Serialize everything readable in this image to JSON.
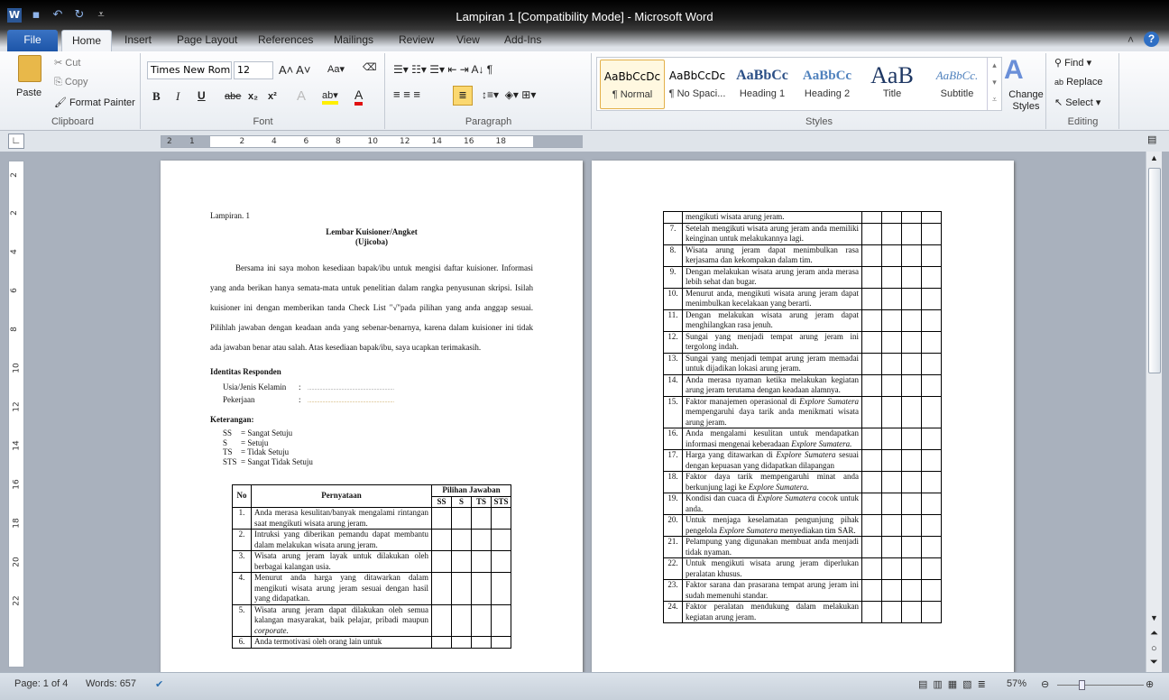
{
  "window": {
    "title": "Lampiran 1 [Compatibility Mode]  -  Microsoft Word"
  },
  "ribbon_tabs": [
    "File",
    "Home",
    "Insert",
    "Page Layout",
    "References",
    "Mailings",
    "Review",
    "View",
    "Add-Ins"
  ],
  "clipboard": {
    "paste": "Paste",
    "cut": "Cut",
    "copy": "Copy",
    "format_painter": "Format Painter",
    "label": "Clipboard"
  },
  "font": {
    "name": "Times New Rom",
    "size": "12",
    "label": "Font",
    "bold": "B",
    "italic": "I",
    "underline": "U",
    "strike": "abe"
  },
  "paragraph": {
    "label": "Paragraph"
  },
  "styles": {
    "label": "Styles",
    "items": [
      {
        "preview": "AaBbCcDc",
        "name": "¶ Normal",
        "selected": true
      },
      {
        "preview": "AaBbCcDc",
        "name": "¶ No Spaci..."
      },
      {
        "preview": "AaBbCc",
        "name": "Heading 1"
      },
      {
        "preview": "AaBbCc",
        "name": "Heading 2"
      },
      {
        "preview": "AaB",
        "name": "Title"
      },
      {
        "preview": "AaBbCc.",
        "name": "Subtitle"
      }
    ],
    "change_styles": "Change Styles"
  },
  "editing": {
    "label": "Editing",
    "find": "Find",
    "replace": "Replace",
    "select": "Select"
  },
  "ruler": {
    "h_numbers": [
      "2",
      "1",
      "2",
      "4",
      "6",
      "8",
      "10",
      "12",
      "14",
      "16",
      "18"
    ],
    "v_numbers": [
      "2",
      "2",
      "4",
      "6",
      "8",
      "10",
      "12",
      "14",
      "16",
      "18",
      "20",
      "22"
    ]
  },
  "doc": {
    "lampiran": "Lampiran. 1",
    "title1": "Lembar Kuisioner/Angket",
    "title2": "(Ujicoba)",
    "intro": "Bersama ini saya mohon kesediaan bapak/ibu untuk mengisi daftar kuisioner. Informasi yang anda berikan hanya semata-mata untuk penelitian dalam rangka penyusunan skripsi. Isilah kuisioner ini dengan memberikan tanda Check List \"√\"pada pilihan yang anda anggap sesuai. Pilihlah jawaban dengan keadaan anda yang sebenar-benarnya, karena dalam kuisioner ini tidak ada jawaban benar atau salah. Atas kesediaan bapak/ibu, saya ucapkan terimakasih.",
    "identitas": "Identitas Responden",
    "fields": [
      {
        "label": "Usia/Jenis Kelamin",
        "sep": ":",
        "value": "................................................................"
      },
      {
        "label": "Pekerjaan",
        "sep": ":",
        "value": "................................................................"
      }
    ],
    "keterangan": "Keterangan:",
    "legend": [
      {
        "k": "SS",
        "v": "=  Sangat Setuju"
      },
      {
        "k": "S",
        "v": "=  Setuju"
      },
      {
        "k": "TS",
        "v": "=  Tidak Setuju"
      },
      {
        "k": "STS",
        "v": "=  Sangat Tidak Setuju"
      }
    ],
    "table_head": {
      "no": "No",
      "pernyataan": "Pernyataan",
      "pilihan": "Pilihan Jawaban",
      "options": [
        "SS",
        "S",
        "TS",
        "STS"
      ]
    },
    "rows_page1": [
      {
        "no": "1.",
        "text": [
          {
            "t": "Anda merasa kesulitan/banyak mengalami rintangan saat mengikuti wisata arung jeram."
          }
        ]
      },
      {
        "no": "2.",
        "text": [
          {
            "t": "Intruksi yang diberikan pemandu dapat membantu dalam melakukan wisata arung jeram."
          }
        ]
      },
      {
        "no": "3.",
        "text": [
          {
            "t": "Wisata arung jeram layak untuk dilakukan oleh berbagai kalangan usia."
          }
        ]
      },
      {
        "no": "4.",
        "text": [
          {
            "t": "Menurut anda harga yang ditawarkan dalam mengikuti wisata arung jeram sesuai dengan hasil yang didapatkan."
          }
        ]
      },
      {
        "no": "5.",
        "text": [
          {
            "t": "Wisata arung jeram dapat dilakukan oleh semua kalangan masyarakat, baik pelajar, pribadi maupun "
          },
          {
            "t": "corporate",
            "i": true
          },
          {
            "t": "."
          }
        ]
      },
      {
        "no": "6.",
        "text": [
          {
            "t": "Anda termotivasi oleh orang lain untuk"
          }
        ]
      }
    ],
    "rows_page2": [
      {
        "no": "",
        "text": [
          {
            "t": "mengikuti wisata arung jeram."
          }
        ]
      },
      {
        "no": "7.",
        "text": [
          {
            "t": "Setelah mengikuti wisata arung jeram anda memiliki keinginan untuk melakukannya lagi."
          }
        ]
      },
      {
        "no": "8.",
        "text": [
          {
            "t": "Wisata arung jeram dapat menimbulkan rasa kerjasama dan kekompakan dalam tim."
          }
        ]
      },
      {
        "no": "9.",
        "text": [
          {
            "t": "Dengan melakukan wisata arung jeram anda merasa lebih sehat dan bugar."
          }
        ]
      },
      {
        "no": "10.",
        "text": [
          {
            "t": "Menurut anda, mengikuti wisata arung jeram dapat menimbulkan kecelakaan yang berarti."
          }
        ]
      },
      {
        "no": "11.",
        "text": [
          {
            "t": "Dengan melakukan wisata arung jeram dapat menghilangkan rasa jenuh."
          }
        ]
      },
      {
        "no": "12.",
        "text": [
          {
            "t": "Sungai yang menjadi tempat arung jeram ini tergolong indah."
          }
        ]
      },
      {
        "no": "13.",
        "text": [
          {
            "t": "Sungai yang menjadi tempat arung jeram memadai untuk dijadikan lokasi arung jeram."
          }
        ]
      },
      {
        "no": "14.",
        "text": [
          {
            "t": "Anda merasa nyaman ketika melakukan kegiatan arung jeram terutama dengan keadaan alamnya."
          }
        ]
      },
      {
        "no": "15.",
        "text": [
          {
            "t": "Faktor manajemen operasional di "
          },
          {
            "t": "Explore Sumatera",
            "i": true
          },
          {
            "t": " mempengaruhi daya tarik anda menikmati wisata arung jeram."
          }
        ]
      },
      {
        "no": "16.",
        "text": [
          {
            "t": "Anda mengalami kesulitan untuk mendapatkan informasi mengenai keberadaan "
          },
          {
            "t": "Explore Sumatera.",
            "i": true
          }
        ]
      },
      {
        "no": "17.",
        "text": [
          {
            "t": "Harga yang ditawarkan di "
          },
          {
            "t": "Explore Sumatera",
            "i": true
          },
          {
            "t": " sesuai dengan kepuasan yang didapatkan dilapangan"
          }
        ]
      },
      {
        "no": "18.",
        "text": [
          {
            "t": "Faktor daya tarik mempengaruhi minat anda berkunjung lagi ke "
          },
          {
            "t": "Explore Sumatera.",
            "i": true
          }
        ]
      },
      {
        "no": "19.",
        "text": [
          {
            "t": "Kondisi dan cuaca di "
          },
          {
            "t": "Explore Sumatera",
            "i": true
          },
          {
            "t": " cocok untuk anda."
          }
        ]
      },
      {
        "no": "20.",
        "text": [
          {
            "t": "Untuk menjaga keselamatan pengunjung pihak pengelola "
          },
          {
            "t": "Explore Sumatera",
            "i": true
          },
          {
            "t": " menyediakan tim SAR."
          }
        ]
      },
      {
        "no": "21.",
        "text": [
          {
            "t": "Pelampung yang digunakan membuat anda menjadi tidak nyaman."
          }
        ]
      },
      {
        "no": "22.",
        "text": [
          {
            "t": "Untuk mengikuti wisata arung jeram diperlukan peralatan khusus."
          }
        ]
      },
      {
        "no": "23.",
        "text": [
          {
            "t": "Faktor sarana dan prasarana tempat arung jeram ini sudah memenuhi standar."
          }
        ]
      },
      {
        "no": "24.",
        "text": [
          {
            "t": "Faktor peralatan mendukung dalam melakukan kegiatan arung jeram."
          }
        ]
      }
    ]
  },
  "status": {
    "page": "Page: 1 of 4",
    "words": "Words: 657",
    "zoom": "57%",
    "zoom_level_percent": 57
  }
}
